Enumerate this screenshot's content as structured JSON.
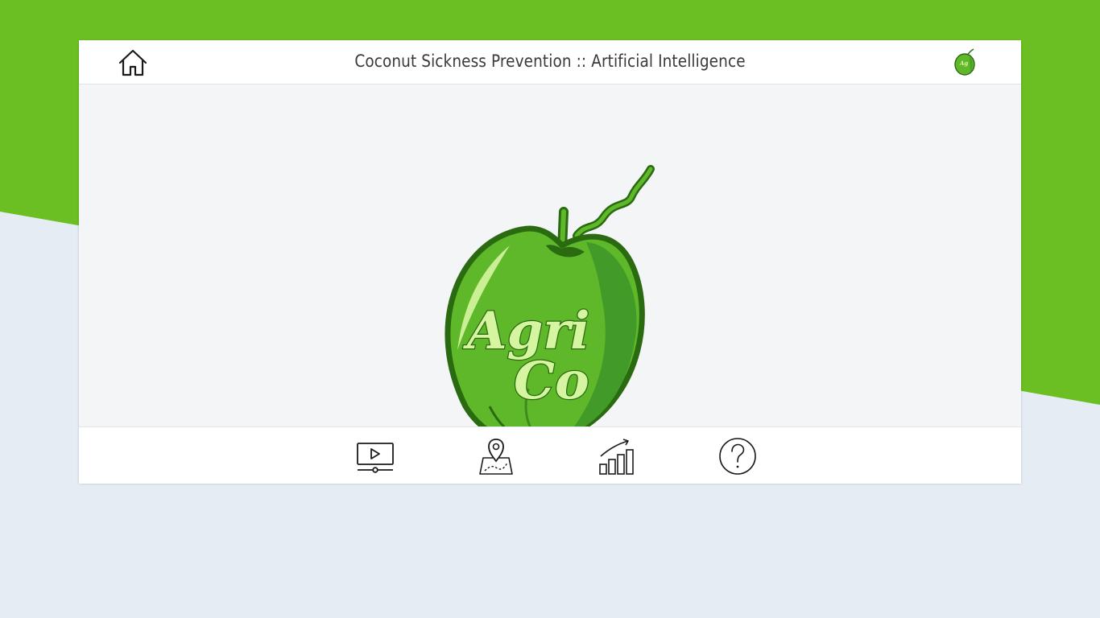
{
  "header": {
    "title": "Coconut Sickness Prevention :: Artificial Intelligence",
    "home_icon": "home-icon",
    "brand_icon": "coconut-logo-icon"
  },
  "logo": {
    "line1": "Agri",
    "line2": "Co"
  },
  "bottom_nav": {
    "items": [
      {
        "icon": "video-player-icon"
      },
      {
        "icon": "map-location-icon"
      },
      {
        "icon": "bar-chart-growth-icon"
      },
      {
        "icon": "help-question-icon"
      }
    ]
  },
  "colors": {
    "banner_green": "#6cbf22",
    "page_background": "#e5ecf4",
    "coconut_green": "#5fb829",
    "coconut_outline": "#2a6a10",
    "logo_text": "#d6f5a0"
  }
}
